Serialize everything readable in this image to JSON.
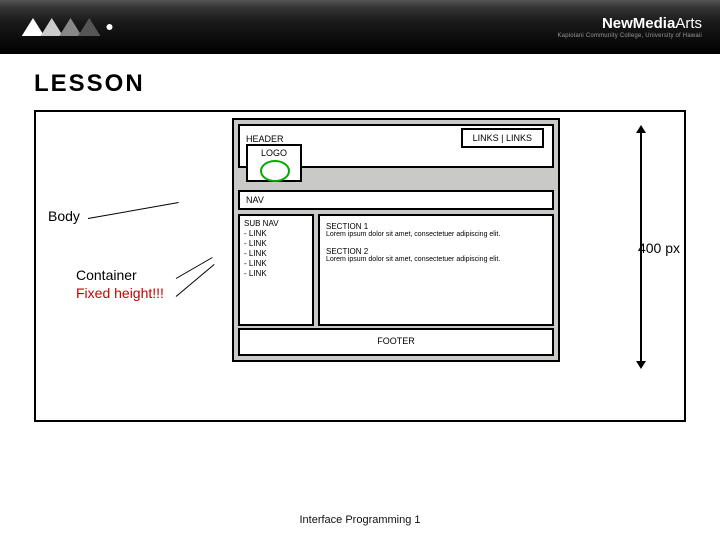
{
  "banner": {
    "brand_bold": "NewMedia",
    "brand_light": "Arts",
    "subtitle": "Kapiolani Community College, University of Hawaii"
  },
  "slide": {
    "title": "LESSON",
    "body_label": "Body",
    "container_label_line1": "Container",
    "container_label_line2": "Fixed height!!!",
    "dimension_label": "400 px",
    "footer": "Interface Programming 1"
  },
  "wf": {
    "header_label": "HEADER",
    "links_text": "LINKS | LINKS",
    "logo_label": "LOGO",
    "nav_label": "NAV",
    "subnav": {
      "title": "SUB NAV",
      "items": [
        "- LINK",
        "- LINK",
        "- LINK",
        "- LINK",
        "- LINK"
      ]
    },
    "content": {
      "sec1_title": "SECTION 1",
      "sec1_text": "Lorem ipsum dolor sit amet, consectetuer adipiscing elit.",
      "sec2_title": "SECTION 2",
      "sec2_text": "Lorem ipsum dolor sit amet, consectetuer adipiscing elit."
    },
    "footer_label": "FOOTER"
  }
}
